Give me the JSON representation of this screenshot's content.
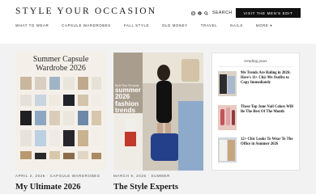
{
  "header": {
    "logo": "STYLE YOUR OCCASION",
    "search_label": "SEARCH",
    "cta_label": "VISIT THE MEN'S EDIT",
    "nav": [
      "WHAT TO WEAR",
      "CAPSULE WARDROBES",
      "FALL STYLE",
      "OLD MONEY",
      "TRAVEL",
      "NAILS",
      "MORE ▾"
    ]
  },
  "posts": [
    {
      "overlay_line1": "Summer Capsule",
      "overlay_line2": "Wardrobe 2026",
      "meta": "APRIL 2, 2026 · CAPSULE WARDROBES",
      "title": "My Ultimate 2026"
    },
    {
      "overlay_small": "Style Your Occasion",
      "overlay_line1": "summer",
      "overlay_line2": "2026",
      "overlay_line3": "fashion",
      "overlay_line4": "trends",
      "meta": "MARCH 9, 2026 · SUMMER",
      "title": "The Style Experts"
    }
  ],
  "trending": {
    "heading": "trending posts",
    "items": [
      {
        "title": "90s Trends Are Ruling in 2026: Here's 11+ Chic 90s Outfits to Copy Immediately"
      },
      {
        "title": "These Top June Nail Colors Will Be The Best Of The Month"
      },
      {
        "title": "12+ Chic Looks To Wear To The Office in Summer 2026"
      }
    ]
  },
  "colors": {
    "cta_bg": "#111111",
    "page_bg": "#f2f2f2"
  }
}
